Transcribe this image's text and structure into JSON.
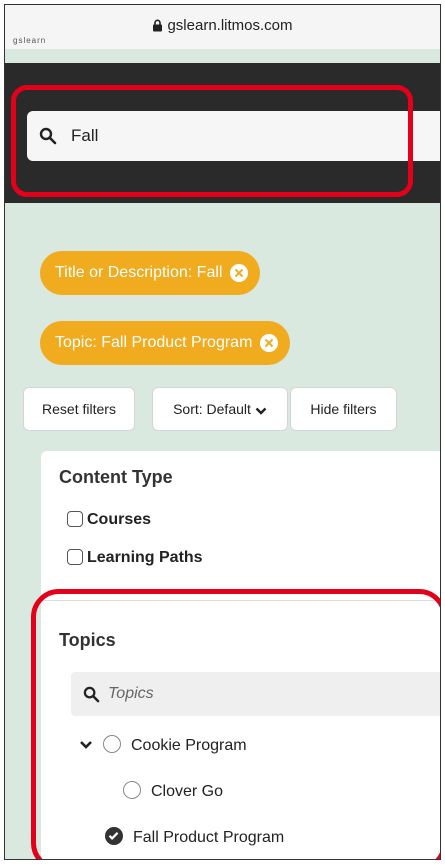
{
  "browser": {
    "url": "gslearn.litmos.com",
    "site_stub": "gslearn"
  },
  "search": {
    "value": "Fall"
  },
  "chips": [
    {
      "label": "Title or Description: Fall"
    },
    {
      "label": "Topic: Fall Product Program"
    }
  ],
  "toolbar": {
    "reset_label": "Reset filters",
    "sort_label": "Sort: Default",
    "hide_label": "Hide filters"
  },
  "content_type": {
    "heading": "Content Type",
    "options": [
      "Courses",
      "Learning Paths"
    ]
  },
  "topics": {
    "heading": "Topics",
    "search_placeholder": "Topics",
    "items": [
      {
        "label": "Cookie Program",
        "checked": false,
        "expanded": true
      },
      {
        "label": "Clover Go",
        "checked": false
      },
      {
        "label": "Fall Product Program",
        "checked": true
      }
    ]
  },
  "colors": {
    "chip": "#f0ab1f",
    "highlight": "#e2001a",
    "background": "#d9e9e0",
    "dark_bar": "#2a2a2a"
  }
}
